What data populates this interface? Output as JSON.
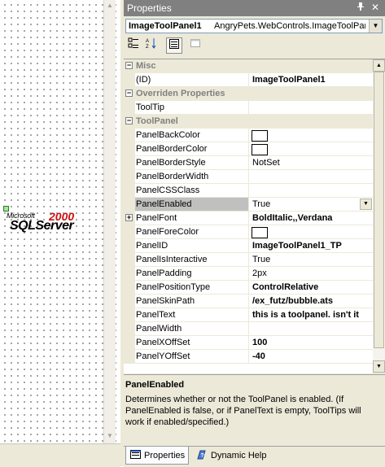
{
  "designer": {
    "logo": {
      "microsoft": "Microsoft",
      "sql_server": "SQLServer",
      "year": "2000"
    }
  },
  "panel": {
    "title": "Properties",
    "title_icons": [
      "pin-icon",
      "close-icon"
    ],
    "object_selector": {
      "name": "ImageToolPanel1",
      "type": "AngryPets.WebControls.ImageToolPan"
    },
    "toolbar": [
      "categorized-icon",
      "alphabetical-icon",
      "properties-icon",
      "property-pages-icon"
    ],
    "grid": {
      "rows": [
        {
          "kind": "category",
          "label": "Misc",
          "expanded": true
        },
        {
          "kind": "prop",
          "name": "(ID)",
          "value": "ImageToolPanel1",
          "bold": true
        },
        {
          "kind": "category",
          "label": "Overriden Properties",
          "expanded": true
        },
        {
          "kind": "prop",
          "name": "ToolTip",
          "value": ""
        },
        {
          "kind": "category",
          "label": "ToolPanel",
          "expanded": true
        },
        {
          "kind": "prop",
          "name": "PanelBackColor",
          "value": "",
          "swatch": "#ffffff"
        },
        {
          "kind": "prop",
          "name": "PanelBorderColor",
          "value": "",
          "swatch": "#ffffff"
        },
        {
          "kind": "prop",
          "name": "PanelBorderStyle",
          "value": "NotSet"
        },
        {
          "kind": "prop",
          "name": "PanelBorderWidth",
          "value": ""
        },
        {
          "kind": "prop",
          "name": "PanelCSSClass",
          "value": ""
        },
        {
          "kind": "prop",
          "name": "PanelEnabled",
          "value": "True",
          "selected": true,
          "dropdown": true
        },
        {
          "kind": "prop",
          "name": "PanelFont",
          "value": "BoldItalic,,Verdana",
          "bold": true,
          "expandable": true
        },
        {
          "kind": "prop",
          "name": "PanelForeColor",
          "value": "",
          "swatch": "#ffffff"
        },
        {
          "kind": "prop",
          "name": "PanelID",
          "value": "ImageToolPanel1_TP",
          "bold": true
        },
        {
          "kind": "prop",
          "name": "PanelIsInteractive",
          "value": "True"
        },
        {
          "kind": "prop",
          "name": "PanelPadding",
          "value": "2px"
        },
        {
          "kind": "prop",
          "name": "PanelPositionType",
          "value": "ControlRelative",
          "bold": true
        },
        {
          "kind": "prop",
          "name": "PanelSkinPath",
          "value": "/ex_futz/bubble.ats",
          "bold": true
        },
        {
          "kind": "prop",
          "name": "PanelText",
          "value": "this is a toolpanel. isn't it",
          "bold": true
        },
        {
          "kind": "prop",
          "name": "PanelWidth",
          "value": ""
        },
        {
          "kind": "prop",
          "name": "PanelXOffSet",
          "value": "100",
          "bold": true
        },
        {
          "kind": "prop",
          "name": "PanelYOffSet",
          "value": "-40",
          "bold": true
        }
      ]
    },
    "description": {
      "title": "PanelEnabled",
      "text": "Determines whether or not the ToolPanel is enabled. (If PanelEnabled is false, or if PanelText is empty, ToolTips will work if enabled/specified.)"
    },
    "tabs": [
      {
        "label": "Properties",
        "active": true,
        "icon": "properties-tab-icon"
      },
      {
        "label": "Dynamic Help",
        "active": false,
        "icon": "help-tab-icon"
      }
    ]
  }
}
